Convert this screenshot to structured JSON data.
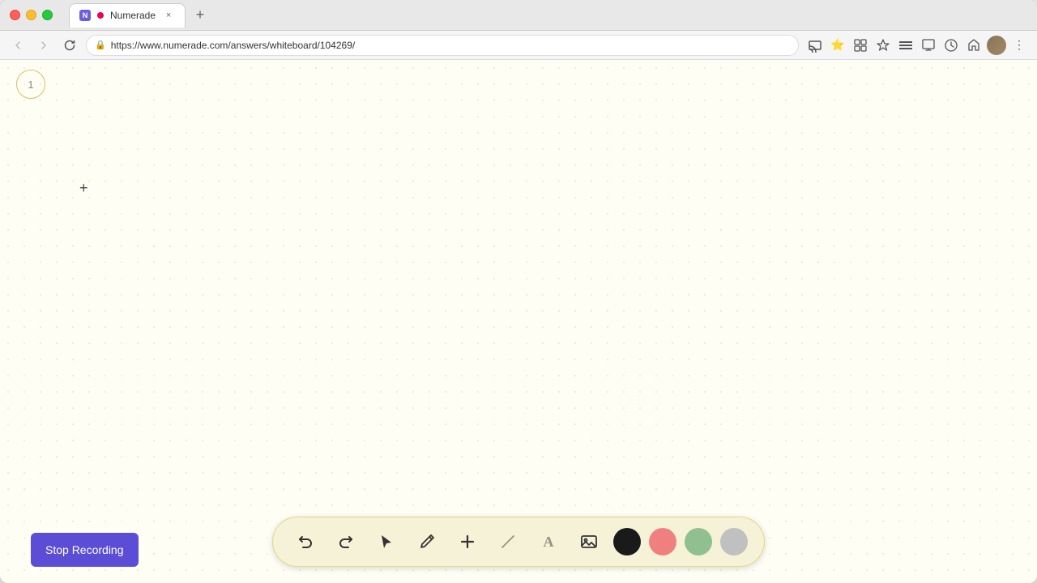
{
  "browser": {
    "traffic_lights": [
      "close",
      "minimize",
      "maximize"
    ],
    "tab": {
      "title": "Numerade",
      "favicon": "N",
      "recording_dot": true,
      "close_label": "×"
    },
    "new_tab_label": "+",
    "address_bar": {
      "url": "https://www.numerade.com/answers/whiteboard/104269/",
      "lock_icon": "🔒"
    }
  },
  "whiteboard": {
    "page_number": "1",
    "background": "dotted"
  },
  "toolbar": {
    "tools": [
      {
        "name": "undo",
        "icon": "↺",
        "label": "Undo"
      },
      {
        "name": "redo",
        "icon": "↻",
        "label": "Redo"
      },
      {
        "name": "select",
        "icon": "▲",
        "label": "Select"
      },
      {
        "name": "pen",
        "icon": "✏",
        "label": "Pen"
      },
      {
        "name": "add",
        "icon": "+",
        "label": "Add"
      },
      {
        "name": "eraser",
        "icon": "/",
        "label": "Eraser"
      },
      {
        "name": "text",
        "icon": "A",
        "label": "Text"
      },
      {
        "name": "image",
        "icon": "🖼",
        "label": "Image"
      }
    ],
    "colors": [
      {
        "name": "black",
        "value": "#1a1a1a"
      },
      {
        "name": "pink",
        "value": "#f08080"
      },
      {
        "name": "green",
        "value": "#90c090"
      },
      {
        "name": "gray",
        "value": "#c0c0c0"
      }
    ]
  },
  "stop_recording": {
    "label": "Stop Recording"
  }
}
